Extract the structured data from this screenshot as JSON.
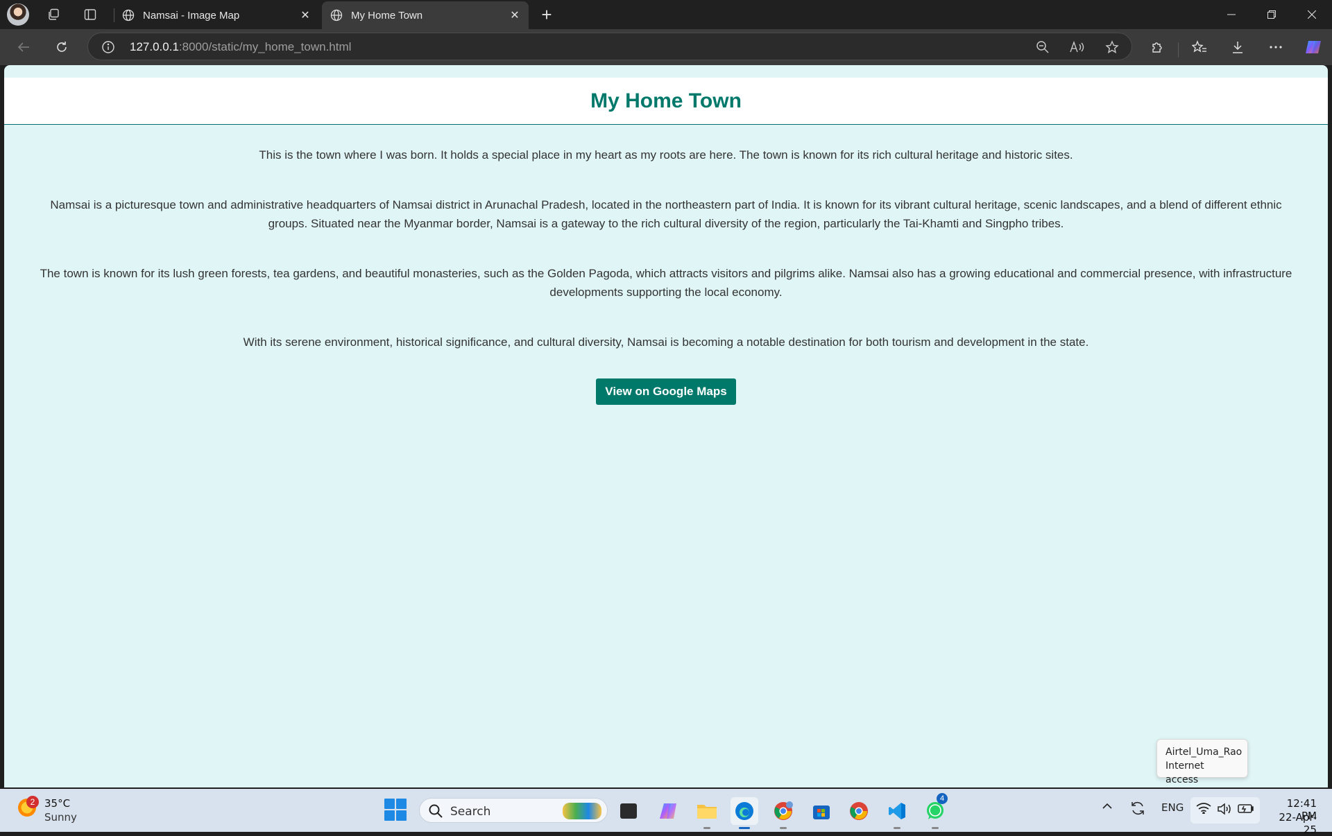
{
  "browser": {
    "tabs": [
      {
        "title": "Namsai - Image Map",
        "active": false
      },
      {
        "title": "My Home Town",
        "active": true
      }
    ],
    "url_host": "127.0.0.1",
    "url_rest": ":8000/static/my_home_town.html"
  },
  "page": {
    "title": "My Home Town",
    "paragraphs": [
      "This is the town where I was born. It holds a special place in my heart as my roots are here. The town is known for its rich cultural heritage and historic sites.",
      "Namsai is a picturesque town and administrative headquarters of Namsai district in Arunachal Pradesh, located in the northeastern part of India. It is known for its vibrant cultural heritage, scenic landscapes, and a blend of different ethnic groups. Situated near the Myanmar border, Namsai is a gateway to the rich cultural diversity of the region, particularly the Tai-Khamti and Singpho tribes.",
      "The town is known for its lush green forests, tea gardens, and beautiful monasteries, such as the Golden Pagoda, which attracts visitors and pilgrims alike. Namsai also has a growing educational and commercial presence, with infrastructure developments supporting the local economy.",
      "With its serene environment, historical significance, and cultural diversity, Namsai is becoming a notable destination for both tourism and development in the state."
    ],
    "maps_button": "View on Google Maps",
    "theme": {
      "accent": "#00796b",
      "background": "#e0f5f6"
    }
  },
  "network_tooltip": {
    "ssid": "Airtel_Uma_Rao",
    "status": "Internet access"
  },
  "taskbar": {
    "weather": {
      "temp": "35°C",
      "condition": "Sunny",
      "badge": "2"
    },
    "search_placeholder": "Search",
    "whatsapp_badge": "4",
    "language": "ENG",
    "time": "12:41 PM",
    "date": "22-Apr-25"
  }
}
